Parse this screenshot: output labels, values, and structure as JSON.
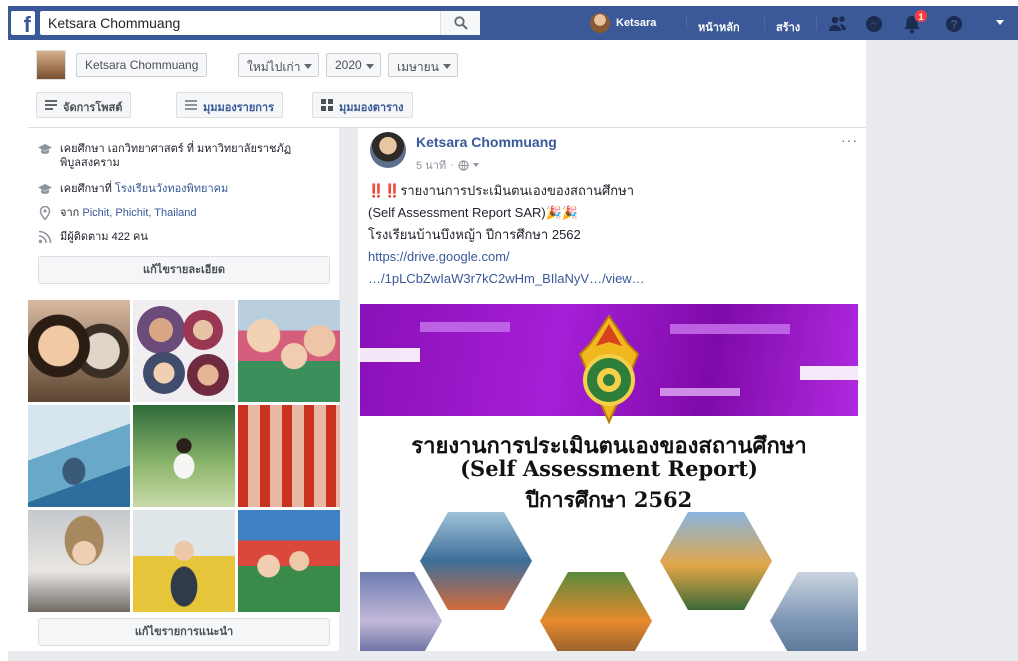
{
  "topbar": {
    "logo": "f",
    "search_value": "Ketsara Chommuang",
    "user_name": "Ketsara",
    "home_label": "หน้าหลัก",
    "create_label": "สร้าง",
    "notif_count": "1",
    "brand_color": "#3b5998"
  },
  "timeline": {
    "name": "Ketsara Chommuang",
    "sort": "ใหม่ไปเก่า",
    "year": "2020",
    "month": "เมษายน",
    "manage_posts": "จัดการโพสต์",
    "list_view": "มุมมองรายการ",
    "grid_view": "มุมมองตาราง"
  },
  "intro": {
    "row1": "เคยศึกษา เอกวิทยาศาสตร์ ที่ มหาวิทยาลัยราชภัฏพิบูลสงคราม",
    "row2_prefix": "เคยศึกษาที่",
    "row2_link": "โรงเรียนวังทองพิทยาคม",
    "row3_prefix": "จาก",
    "row3_link": "Pichit, Phichit, Thailand",
    "row4": "มีผู้ติดตาม 422 คน",
    "edit_details": "แก้ไขรายละเอียด",
    "edit_featured": "แก้ไขรายการแนะนำ"
  },
  "post": {
    "author": "Ketsara Chommuang",
    "time": "5 นาที",
    "more": "···",
    "line1": "‼️‼️รายงานการประเมินตนเองของสถานศึกษา",
    "line2": "(Self Assessment Report SAR)🎉🎉",
    "line3": "โรงเรียนบ้านบึงหญ้า ปีการศึกษา 2562",
    "link1": "https://drive.google.com/",
    "link2": "…/1pLCbZwIaW3r7kC2wHm_BIlaNyV…/view…",
    "image_title1": "รายงานการประเมินตนเองของสถานศึกษา",
    "image_title2": "(Self Assessment Report)",
    "image_title3": "ปีการศึกษา 2562"
  },
  "icons": {
    "search": "search-icon",
    "school": "graduation-icon",
    "location": "map-pin-icon",
    "followers": "rss-icon",
    "globe": "globe-icon"
  }
}
